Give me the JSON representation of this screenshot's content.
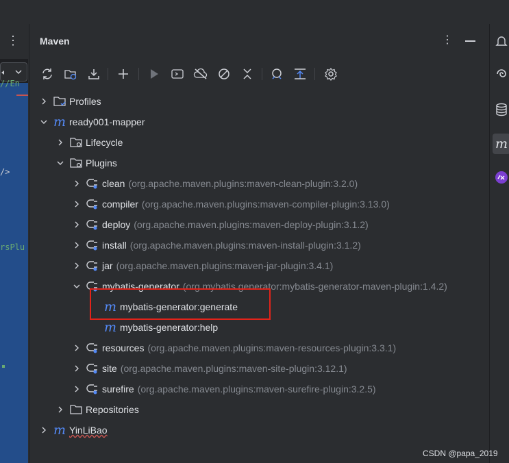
{
  "editor_fragments": {
    "line1": "//En",
    "line2": "/>",
    "line3": "rsPlu"
  },
  "panel": {
    "title": "Maven"
  },
  "toolbar": {
    "buttons": [
      "refresh-icon",
      "reimport-icon",
      "download-icon",
      "add-icon",
      "run-icon",
      "execute-goal-icon",
      "offline-icon",
      "skip-tests-icon",
      "collapse-icon",
      "analyze-icon",
      "show-dependencies-icon",
      "settings-icon"
    ]
  },
  "tree": {
    "profiles": "Profiles",
    "project": "ready001-mapper",
    "lifecycle": "Lifecycle",
    "plugins": "Plugins",
    "plugin_list": [
      {
        "name": "clean",
        "coord": "(org.apache.maven.plugins:maven-clean-plugin:3.2.0)"
      },
      {
        "name": "compiler",
        "coord": "(org.apache.maven.plugins:maven-compiler-plugin:3.13.0)"
      },
      {
        "name": "deploy",
        "coord": "(org.apache.maven.plugins:maven-deploy-plugin:3.1.2)"
      },
      {
        "name": "install",
        "coord": "(org.apache.maven.plugins:maven-install-plugin:3.1.2)"
      },
      {
        "name": "jar",
        "coord": "(org.apache.maven.plugins:maven-jar-plugin:3.4.1)"
      },
      {
        "name": "mybatis-generator",
        "coord": "(org.mybatis.generator:mybatis-generator-maven-plugin:1.4.2)"
      },
      {
        "name": "resources",
        "coord": "(org.apache.maven.plugins:maven-resources-plugin:3.3.1)"
      },
      {
        "name": "site",
        "coord": "(org.apache.maven.plugins:maven-site-plugin:3.12.1)"
      },
      {
        "name": "surefire",
        "coord": "(org.apache.maven.plugins:maven-surefire-plugin:3.2.5)"
      }
    ],
    "goals": [
      "mybatis-generator:generate",
      "mybatis-generator:help"
    ],
    "repositories": "Repositories",
    "project2": "YinLiBao"
  },
  "colors": {
    "accent": "#548af7",
    "highlight": "#e2231a",
    "editor_bg": "#234d8a"
  },
  "watermark": "CSDN @papa_2019"
}
